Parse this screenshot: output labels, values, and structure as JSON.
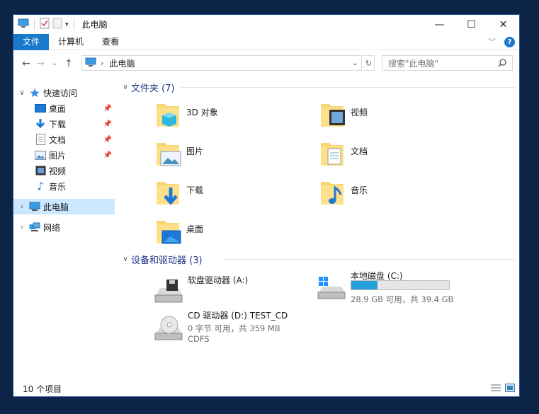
{
  "window": {
    "title": "此电脑"
  },
  "ribbon": {
    "tabs": [
      "文件",
      "计算机",
      "查看"
    ]
  },
  "address": {
    "path": "此电脑"
  },
  "search": {
    "placeholder": "搜索\"此电脑\""
  },
  "sidebar": {
    "quick_access": "快速访问",
    "items": [
      {
        "label": "桌面",
        "icon": "desktop-icon",
        "pinned": true
      },
      {
        "label": "下载",
        "icon": "download-icon",
        "pinned": true
      },
      {
        "label": "文档",
        "icon": "document-icon",
        "pinned": true
      },
      {
        "label": "图片",
        "icon": "picture-icon",
        "pinned": true
      },
      {
        "label": "视频",
        "icon": "video-icon",
        "pinned": false
      },
      {
        "label": "音乐",
        "icon": "music-icon",
        "pinned": false
      }
    ],
    "this_pc": "此电脑",
    "network": "网络"
  },
  "folders": {
    "header": "文件夹 (7)",
    "items": [
      "3D 对象",
      "视频",
      "图片",
      "文档",
      "下载",
      "音乐",
      "桌面"
    ]
  },
  "devices": {
    "header": "设备和驱动器 (3)",
    "floppy": {
      "label": "软盘驱动器 (A:)"
    },
    "local": {
      "label": "本地磁盘 (C:)",
      "free_text": "28.9 GB 可用，共 39.4 GB",
      "used_fraction": 0.27
    },
    "cd": {
      "label": "CD 驱动器 (D:) TEST_CD",
      "free_text": "0 字节 可用，共 359 MB",
      "fs": "CDFS"
    }
  },
  "status": {
    "count": "10 个项目"
  },
  "colors": {
    "accent": "#1979ca",
    "selection": "#cce8ff",
    "group_header": "#1e3287",
    "bar_fill": "#26a0da"
  }
}
